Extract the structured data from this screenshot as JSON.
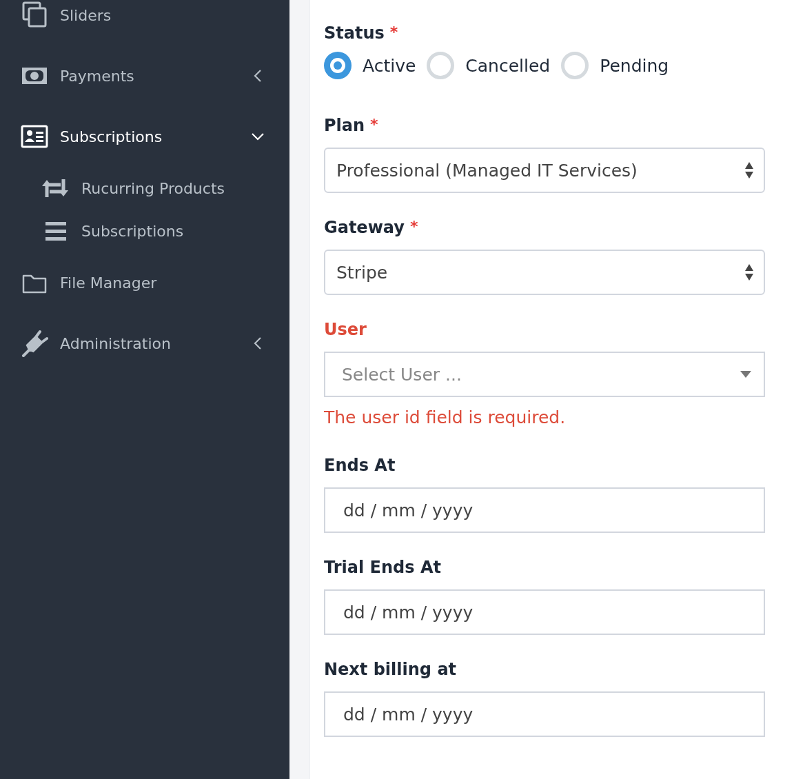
{
  "sidebar": {
    "items": [
      {
        "label": "Sliders",
        "selected": false
      },
      {
        "label": "Payments",
        "selected": false,
        "expanded": false
      },
      {
        "label": "Subscriptions",
        "selected": true,
        "expanded": true,
        "children": [
          {
            "label": "Rucurring Products",
            "selected": false
          },
          {
            "label": "Subscriptions",
            "selected": false
          }
        ]
      },
      {
        "label": "File Manager",
        "selected": false
      },
      {
        "label": "Administration",
        "selected": false,
        "expanded": false
      }
    ]
  },
  "form": {
    "fields": [
      {
        "kind": "radio",
        "label": "Status",
        "required_mark": "*",
        "options": [
          {
            "label": "Active",
            "selected": true
          },
          {
            "label": "Cancelled",
            "selected": false
          },
          {
            "label": "Pending",
            "selected": false
          }
        ]
      },
      {
        "kind": "select",
        "label": "Plan",
        "required_mark": "*",
        "value": "Professional (Managed IT Services)"
      },
      {
        "kind": "select",
        "label": "Gateway",
        "required_mark": "*",
        "value": "Stripe"
      },
      {
        "kind": "search-select",
        "label": "User",
        "placeholder": "Select User ...",
        "error": "The user id field is required."
      },
      {
        "kind": "date",
        "label": "Ends At",
        "placeholder": "dd / mm / yyyy"
      },
      {
        "kind": "date",
        "label": "Trial Ends At",
        "placeholder": "dd / mm / yyyy"
      },
      {
        "kind": "date",
        "label": "Next billing at",
        "placeholder": "dd / mm / yyyy"
      }
    ]
  }
}
